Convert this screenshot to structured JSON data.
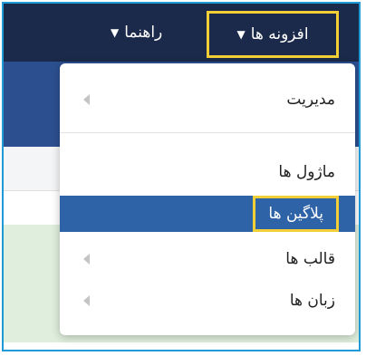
{
  "topbar": {
    "help_label": "راهنما",
    "extensions_label": "افزونه ها",
    "caret": "▼"
  },
  "menu": {
    "items": [
      {
        "label": "مدیریت",
        "has_submenu": true
      },
      {
        "label": "ماژول ها",
        "has_submenu": false
      },
      {
        "label": "پلاگین ها",
        "has_submenu": false,
        "active": true
      },
      {
        "label": "قالب ها",
        "has_submenu": true
      },
      {
        "label": "زبان ها",
        "has_submenu": true
      }
    ]
  },
  "colors": {
    "navbar": "#1b2a4a",
    "subheader": "#2c4f8f",
    "active_item": "#2f63a7",
    "highlight": "#f2cf36",
    "frame": "#1e9ad6",
    "success_band": "#dfeedd"
  }
}
